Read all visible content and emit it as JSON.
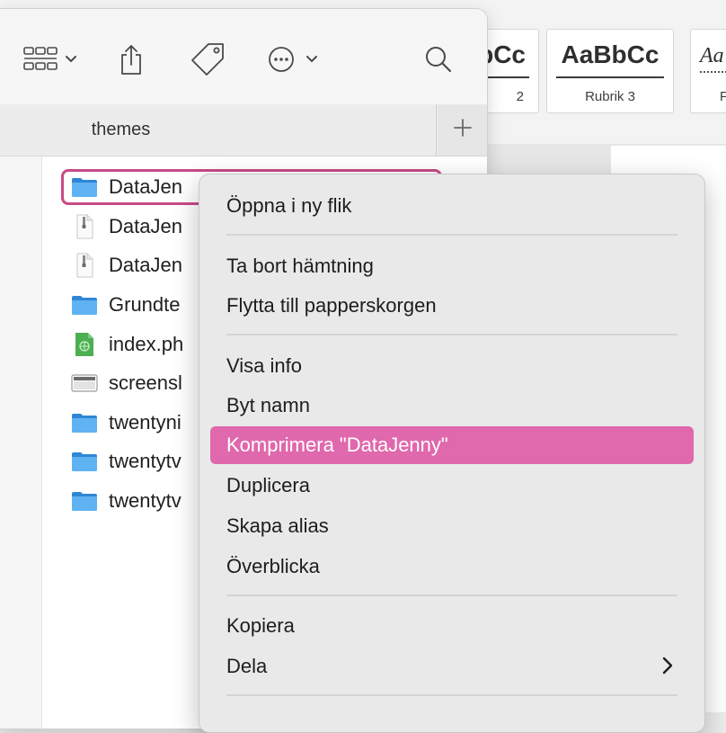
{
  "finder": {
    "tab_title": "themes",
    "files": [
      {
        "name": "DataJen",
        "icon": "folder-icon"
      },
      {
        "name": "DataJen",
        "icon": "zip-archive-icon"
      },
      {
        "name": "DataJen",
        "icon": "zip-archive-icon"
      },
      {
        "name": "Grundte",
        "icon": "folder-icon"
      },
      {
        "name": "index.ph",
        "icon": "php-file-icon"
      },
      {
        "name": "screensl",
        "icon": "screenshot-file-icon"
      },
      {
        "name": "twentyni",
        "icon": "folder-icon"
      },
      {
        "name": "twentytv",
        "icon": "folder-icon"
      },
      {
        "name": "twentytv",
        "icon": "folder-icon"
      }
    ]
  },
  "word": {
    "styles": [
      {
        "sample": "bCc",
        "name": "2"
      },
      {
        "sample": "AaBbCc",
        "name": "Rubrik 3"
      },
      {
        "sample": "Aa",
        "name": "F"
      }
    ]
  },
  "context_menu": {
    "items": [
      {
        "label": "Öppna i ny flik"
      },
      {
        "label": "Ta bort hämtning"
      },
      {
        "label": "Flytta till papperskorgen"
      },
      {
        "label": "Visa info"
      },
      {
        "label": "Byt namn"
      },
      {
        "label": "Komprimera \"DataJenny\""
      },
      {
        "label": "Duplicera"
      },
      {
        "label": "Skapa alias"
      },
      {
        "label": "Överblicka"
      },
      {
        "label": "Kopiera"
      },
      {
        "label": "Dela"
      }
    ],
    "highlighted_index": 5
  },
  "colors": {
    "selection_outline": "#c84b86",
    "menu_highlight": "#e068ac",
    "folder_blue": "#3d9be9"
  }
}
